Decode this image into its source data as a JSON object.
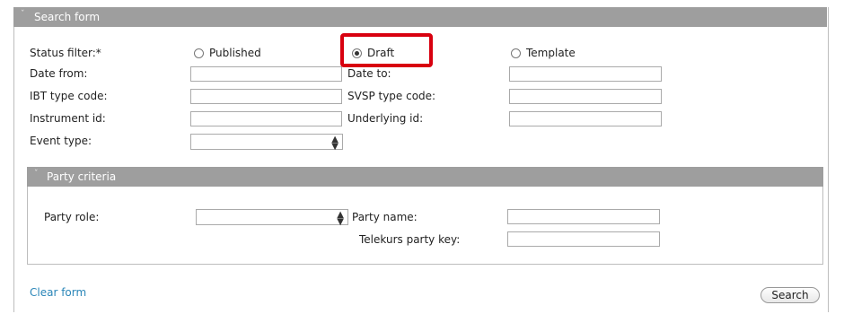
{
  "search_form": {
    "title": "Search form",
    "status_filter": {
      "label": "Status filter:*",
      "options": [
        {
          "label": "Published",
          "checked": false
        },
        {
          "label": "Draft",
          "checked": true
        },
        {
          "label": "Template",
          "checked": false
        }
      ]
    },
    "date_from_label": "Date from:",
    "date_to_label": "Date to:",
    "ibt_type_code_label": "IBT type code:",
    "svsp_type_code_label": "SVSP type code:",
    "instrument_id_label": "Instrument id:",
    "underlying_id_label": "Underlying id:",
    "event_type_label": "Event type:"
  },
  "party_criteria": {
    "title": "Party criteria",
    "party_role_label": "Party role:",
    "party_name_label": "Party name:",
    "telekurs_party_key_label": "Telekurs party key:"
  },
  "footer": {
    "clear_form": "Clear form",
    "search": "Search"
  },
  "colors": {
    "header_bg": "#9e9e9e",
    "highlight": "#d8000f",
    "link": "#2a86b8"
  }
}
